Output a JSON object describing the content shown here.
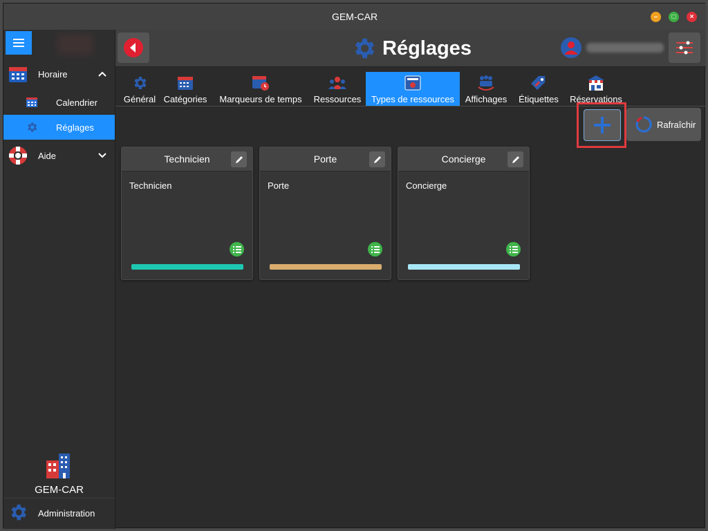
{
  "window": {
    "title": "GEM-CAR"
  },
  "sidebar": {
    "items": [
      {
        "label": "Horaire"
      },
      {
        "label": "Calendrier"
      },
      {
        "label": "Réglages"
      },
      {
        "label": "Aide"
      }
    ],
    "logo_text": "GEM-CAR",
    "admin_label": "Administration"
  },
  "header": {
    "title": "Réglages"
  },
  "tabs": [
    {
      "label": "Général"
    },
    {
      "label": "Catégories"
    },
    {
      "label": "Marqueurs de temps"
    },
    {
      "label": "Ressources"
    },
    {
      "label": "Types de ressources",
      "active": true
    },
    {
      "label": "Affichages"
    },
    {
      "label": "Étiquettes"
    },
    {
      "label": "Réservations"
    }
  ],
  "toolbar": {
    "refresh_label": "Rafraîchir"
  },
  "cards": [
    {
      "title": "Technicien",
      "description": "Technicien",
      "color": "#1ec8b0"
    },
    {
      "title": "Porte",
      "description": "Porte",
      "color": "#d9ad6e"
    },
    {
      "title": "Concierge",
      "description": "Concierge",
      "color": "#a8e6f5"
    }
  ],
  "colors": {
    "accent": "#1e90ff",
    "highlight": "#e03a3e",
    "list_badge": "#3fb54a"
  }
}
